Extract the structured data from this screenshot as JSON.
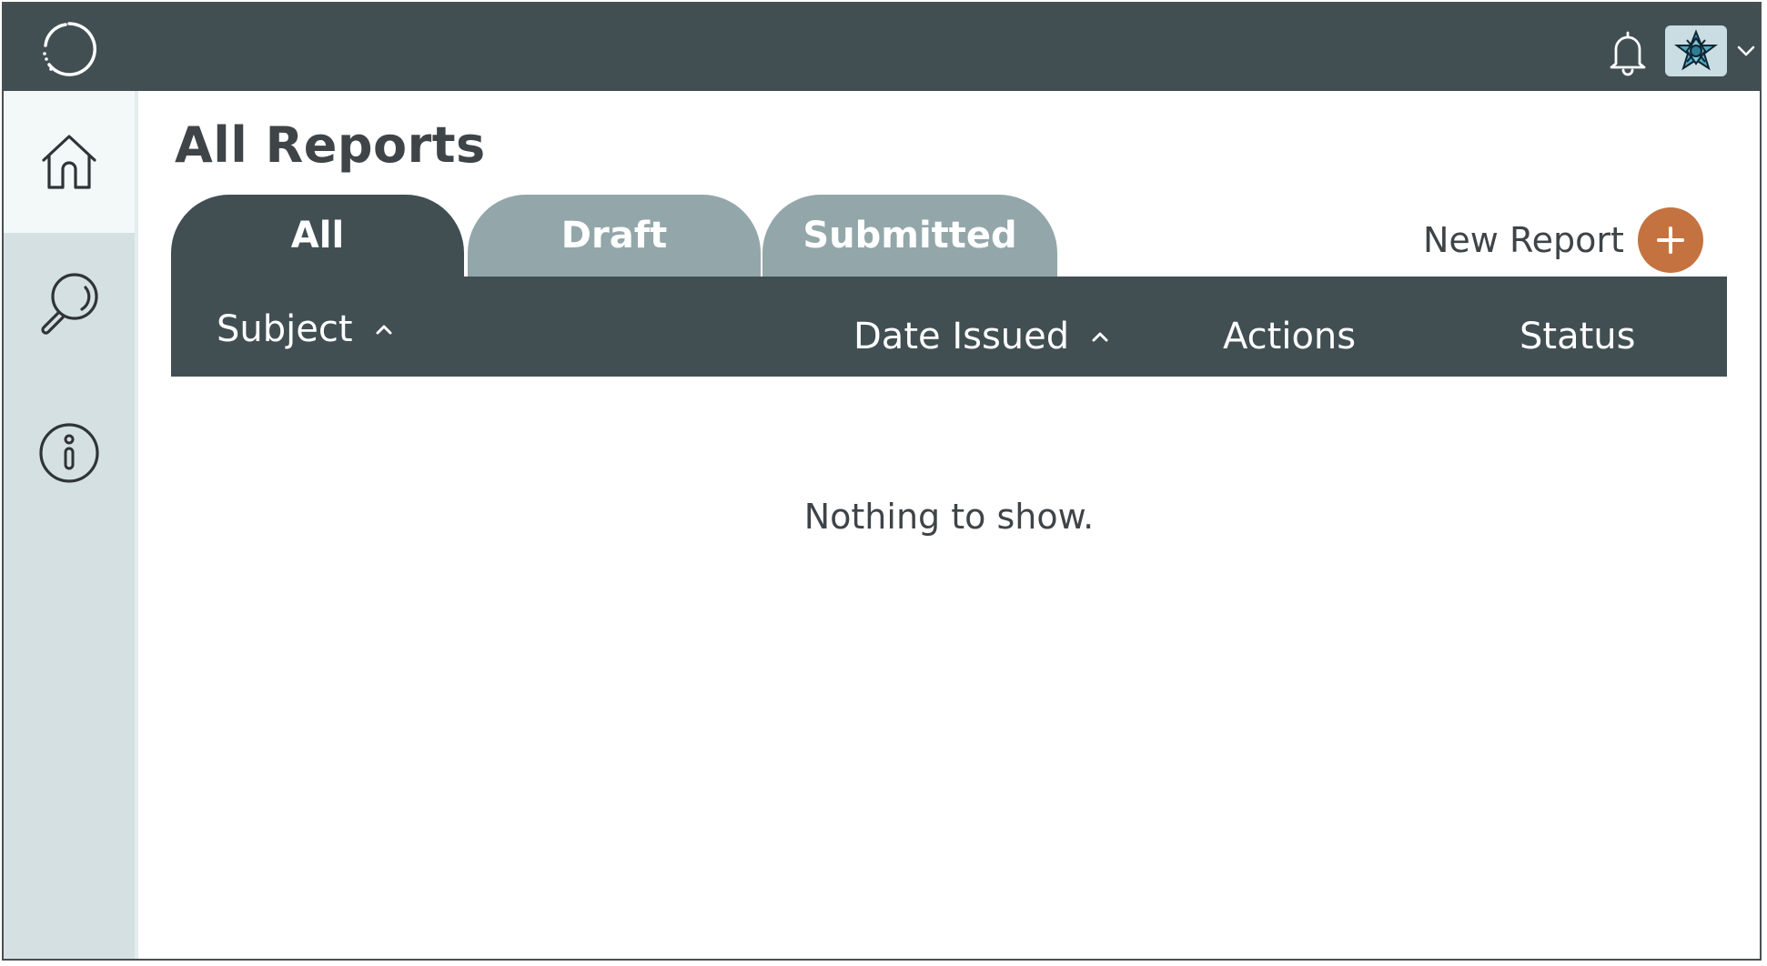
{
  "header": {
    "logo_icon": "loading-circle-icon",
    "notifications_icon": "bell-icon",
    "avatar_icon": "geometric-star-avatar",
    "avatar_menu_icon": "chevron-down-icon"
  },
  "sidebar": {
    "items": [
      {
        "name": "home",
        "icon": "home-icon",
        "active": true
      },
      {
        "name": "search",
        "icon": "search-icon",
        "active": false
      },
      {
        "name": "info",
        "icon": "info-icon",
        "active": false
      }
    ]
  },
  "page": {
    "title": "All Reports"
  },
  "tabs": [
    {
      "label": "All",
      "active": true
    },
    {
      "label": "Draft",
      "active": false
    },
    {
      "label": "Submitted",
      "active": false
    }
  ],
  "actions": {
    "new_report_label": "New Report",
    "add_icon": "plus-icon"
  },
  "table": {
    "columns": [
      {
        "label": "Subject",
        "sortable": true
      },
      {
        "label": "Date Issued",
        "sortable": true
      },
      {
        "label": "Actions",
        "sortable": false
      },
      {
        "label": "Status",
        "sortable": false
      }
    ],
    "rows": [],
    "empty_message": "Nothing to show."
  },
  "colors": {
    "topbar": "#414f53",
    "sidebar": "#d5e0e3",
    "tab_inactive": "#93a7aa",
    "accent": "#c47340",
    "avatar_bg": "#c9dde3"
  }
}
